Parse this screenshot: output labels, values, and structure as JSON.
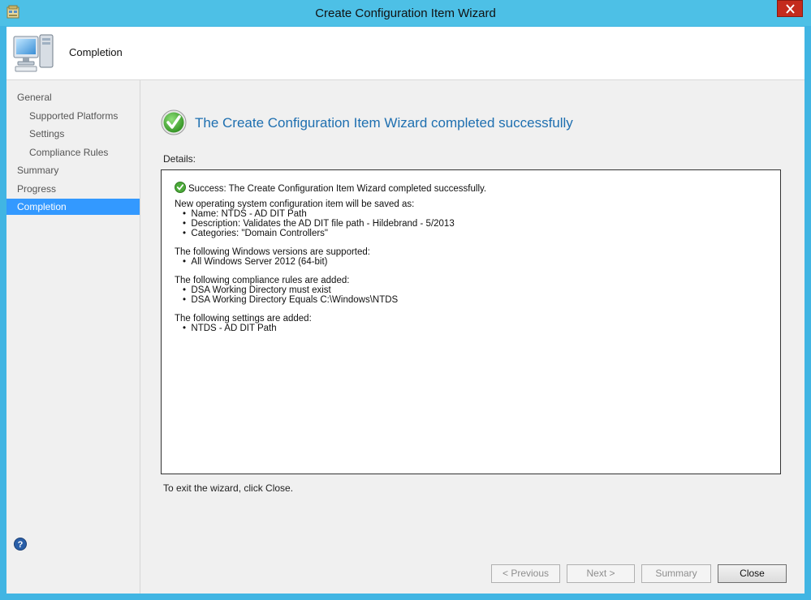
{
  "window": {
    "title": "Create Configuration Item Wizard",
    "accent_color": "#4dc0e6",
    "close_icon": "close-icon"
  },
  "header": {
    "title": "Completion",
    "icon": "computer-icon"
  },
  "nav": {
    "items": [
      {
        "label": "General",
        "level": "top",
        "selected": false
      },
      {
        "label": "Supported Platforms",
        "level": "sub",
        "selected": false
      },
      {
        "label": "Settings",
        "level": "sub",
        "selected": false
      },
      {
        "label": "Compliance Rules",
        "level": "sub",
        "selected": false
      },
      {
        "label": "Summary",
        "level": "top",
        "selected": false
      },
      {
        "label": "Progress",
        "level": "top",
        "selected": false
      },
      {
        "label": "Completion",
        "level": "top",
        "selected": true
      }
    ],
    "selected_color": "#3399ff"
  },
  "main": {
    "headline": "The Create Configuration Item Wizard completed successfully",
    "details_label": "Details:",
    "details": {
      "success_line": "Success: The Create Configuration Item Wizard completed successfully.",
      "saved_intro": "New operating system configuration item will be saved as:",
      "saved_items": [
        "Name: NTDS - AD DIT Path",
        "Description: Validates the AD DIT file path - Hildebrand - 5/2013",
        "Categories: \"Domain Controllers\""
      ],
      "versions_intro": "The following Windows versions are supported:",
      "versions_items": [
        "All Windows Server 2012 (64-bit)"
      ],
      "rules_intro": "The following compliance rules are added:",
      "rules_items": [
        "DSA Working Directory must exist",
        "DSA Working Directory Equals C:\\Windows\\NTDS"
      ],
      "settings_intro": "The following settings are added:",
      "settings_items": [
        "NTDS - AD DIT Path"
      ]
    },
    "exit_text": "To exit the wizard, click Close."
  },
  "footer": {
    "help_icon": "help-icon",
    "buttons": {
      "previous": "< Previous",
      "next": "Next >",
      "summary": "Summary",
      "close": "Close"
    }
  }
}
